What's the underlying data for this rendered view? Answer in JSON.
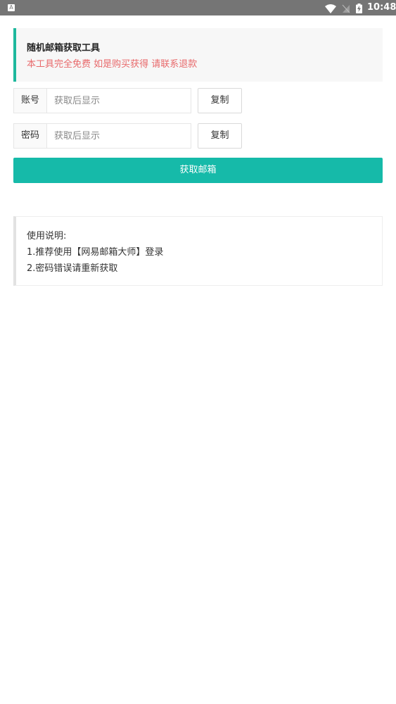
{
  "status_bar": {
    "app_indicator": "A",
    "time": "10:48",
    "icons": [
      "wifi-icon",
      "no-sim-icon",
      "battery-charging-icon"
    ]
  },
  "notice": {
    "title": "随机邮箱获取工具",
    "warning": "本工具完全免费 如是购买获得 请联系退款",
    "accent_color": "#1eb89d",
    "warning_color": "#e8696b"
  },
  "account_field": {
    "label": "账号",
    "placeholder": "获取后显示",
    "value": "",
    "copy_label": "复制"
  },
  "password_field": {
    "label": "密码",
    "placeholder": "获取后显示",
    "value": "",
    "copy_label": "复制"
  },
  "get_button": {
    "label": "获取邮箱",
    "color": "#16baa9"
  },
  "instructions": {
    "heading": "使用说明:",
    "items": [
      "1.推荐使用【网易邮箱大师】登录",
      "2.密码错误请重新获取"
    ]
  }
}
